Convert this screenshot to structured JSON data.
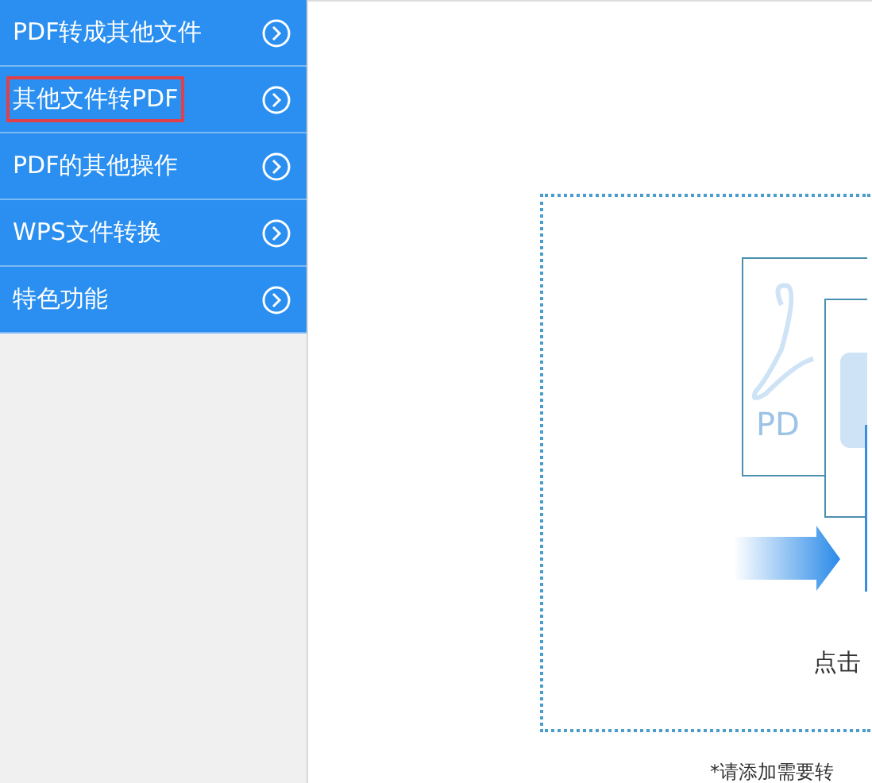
{
  "sidebar": {
    "items": [
      {
        "label": "PDF转成其他文件",
        "highlighted": false
      },
      {
        "label": "其他文件转PDF",
        "highlighted": true
      },
      {
        "label": "PDF的其他操作",
        "highlighted": false
      },
      {
        "label": "WPS文件转换",
        "highlighted": false
      },
      {
        "label": "特色功能",
        "highlighted": false
      }
    ]
  },
  "drop_area": {
    "pdf_card_label": "PD",
    "hint": "点击",
    "note": "*请添加需要转"
  }
}
